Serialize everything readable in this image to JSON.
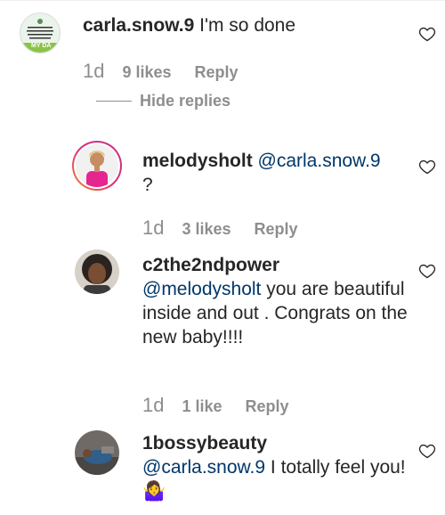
{
  "comments": [
    {
      "username": "carla.snow.9",
      "body": " I'm so done",
      "time": "1d",
      "likes": "9 likes",
      "reply_label": "Reply",
      "avatar_logo_text": "MY DA"
    },
    {
      "username": "melodysholt",
      "mention": "@carla.snow.9",
      "body_line2": "?",
      "time": "1d",
      "likes": "3 likes",
      "reply_label": "Reply"
    },
    {
      "username": "c2the2ndpower",
      "mention": "@melodysholt",
      "body": " you are beautiful inside and out . Congrats on the new baby!!!!",
      "time": "1d",
      "likes": "1 like",
      "reply_label": "Reply"
    },
    {
      "username": "1bossybeauty",
      "mention": "@carla.snow.9",
      "body": " I totally feel you!",
      "emoji": "🤷‍♀️"
    }
  ],
  "hide_replies_label": "Hide replies",
  "icons": {
    "like": "heart-outline-icon",
    "shrug_emoji": "woman-shrugging-emoji"
  },
  "colors": {
    "text": "#262626",
    "secondary": "#8e8e8e",
    "mention": "#00376b",
    "story_ring_start": "#f58529",
    "story_ring_end": "#dd2a7b"
  }
}
